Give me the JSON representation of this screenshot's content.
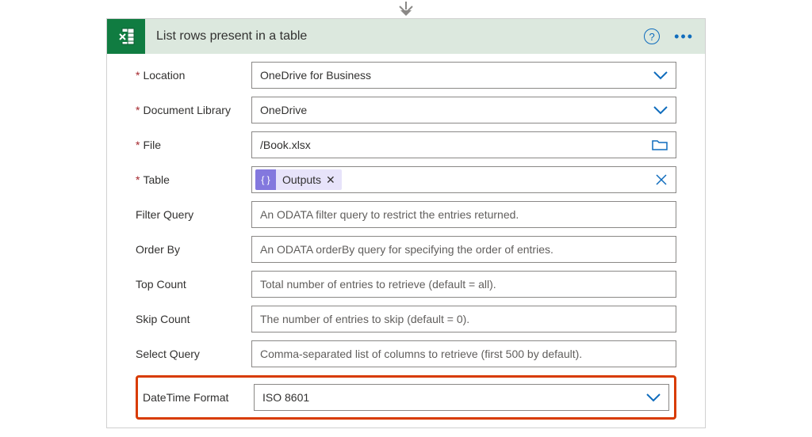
{
  "header": {
    "title": "List rows present in a table"
  },
  "fields": {
    "location": {
      "label": "Location",
      "required": true,
      "value": "OneDrive for Business",
      "type": "dropdown"
    },
    "library": {
      "label": "Document Library",
      "required": true,
      "value": "OneDrive",
      "type": "dropdown"
    },
    "file": {
      "label": "File",
      "required": true,
      "value": "/Book.xlsx",
      "type": "filepicker"
    },
    "table": {
      "label": "Table",
      "required": true,
      "token": "Outputs",
      "type": "token-dropdown"
    },
    "filter": {
      "label": "Filter Query",
      "required": false,
      "placeholder": "An ODATA filter query to restrict the entries returned."
    },
    "orderby": {
      "label": "Order By",
      "required": false,
      "placeholder": "An ODATA orderBy query for specifying the order of entries."
    },
    "top": {
      "label": "Top Count",
      "required": false,
      "placeholder": "Total number of entries to retrieve (default = all)."
    },
    "skip": {
      "label": "Skip Count",
      "required": false,
      "placeholder": "The number of entries to skip (default = 0)."
    },
    "select": {
      "label": "Select Query",
      "required": false,
      "placeholder": "Comma-separated list of columns to retrieve (first 500 by default)."
    },
    "datetime": {
      "label": "DateTime Format",
      "required": false,
      "value": "ISO 8601",
      "type": "dropdown"
    }
  }
}
